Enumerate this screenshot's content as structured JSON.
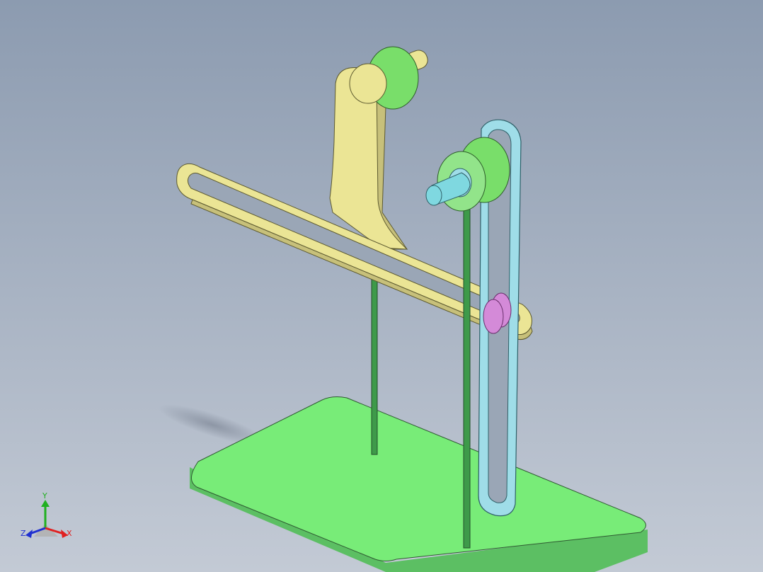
{
  "viewport": {
    "background_top": "#8c9bb0",
    "background_bottom": "#c3cad5"
  },
  "colors": {
    "base_plate": "#78ec78",
    "base_plate_edge": "#5cbf63",
    "rod": "#3e9a4a",
    "bushing": "#79de6a",
    "slotted_arm": "#ebe595",
    "slotted_arm_shadow": "#c7c07a",
    "crank_link": "#9fdde8",
    "crank_shaft": "#7fd8e0",
    "pin": "#d48ad8",
    "axis_x": "#e02020",
    "axis_y": "#20b020",
    "axis_z": "#2030d0"
  },
  "triad": {
    "x_label": "X",
    "y_label": "Y",
    "z_label": "Z"
  }
}
